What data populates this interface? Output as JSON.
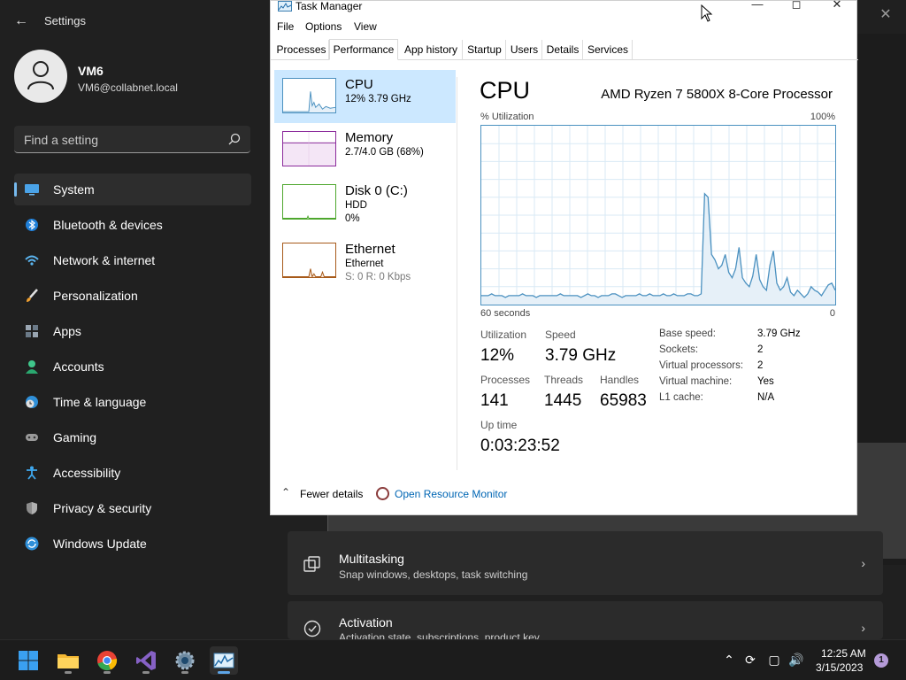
{
  "settings": {
    "title": "Settings",
    "profile": {
      "name": "VM6",
      "email": "VM6@collabnet.local"
    },
    "search": {
      "placeholder": "Find a setting"
    },
    "nav": [
      {
        "label": "System",
        "icon": "monitor-icon",
        "active": true
      },
      {
        "label": "Bluetooth & devices",
        "icon": "bluetooth-icon"
      },
      {
        "label": "Network & internet",
        "icon": "wifi-icon"
      },
      {
        "label": "Personalization",
        "icon": "brush-icon"
      },
      {
        "label": "Apps",
        "icon": "apps-icon"
      },
      {
        "label": "Accounts",
        "icon": "person-icon"
      },
      {
        "label": "Time & language",
        "icon": "clock-globe-icon"
      },
      {
        "label": "Gaming",
        "icon": "gamepad-icon"
      },
      {
        "label": "Accessibility",
        "icon": "accessibility-icon"
      },
      {
        "label": "Privacy & security",
        "icon": "shield-icon"
      },
      {
        "label": "Windows Update",
        "icon": "update-icon"
      }
    ],
    "cards": [
      {
        "title": "Multitasking",
        "subtitle": "Snap windows, desktops, task switching",
        "icon": "multitask-icon"
      },
      {
        "title": "Activation",
        "subtitle": "Activation state, subscriptions, product key",
        "icon": "check-circle-icon"
      }
    ]
  },
  "taskmanager": {
    "title": "Task Manager",
    "menu": [
      "File",
      "Options",
      "View"
    ],
    "tabs": [
      "Processes",
      "Performance",
      "App history",
      "Startup",
      "Users",
      "Details",
      "Services"
    ],
    "active_tab": "Performance",
    "sidebar": [
      {
        "name": "CPU",
        "line1": "12% 3.79 GHz",
        "line2": "",
        "color": "#4b91c0"
      },
      {
        "name": "Memory",
        "line1": "2.7/4.0 GB (68%)",
        "line2": "",
        "color": "#8b2a9b"
      },
      {
        "name": "Disk 0 (C:)",
        "line1": "HDD",
        "line2": "0%",
        "color": "#4ea72e"
      },
      {
        "name": "Ethernet",
        "line1": "Ethernet",
        "line2": "S: 0 R: 0 Kbps",
        "color": "#a75a1a"
      }
    ],
    "cpu": {
      "heading": "CPU",
      "model": "AMD Ryzen 7 5800X 8-Core Processor",
      "util_label": "% Utilization",
      "util_max": "100%",
      "x_left": "60 seconds",
      "x_right": "0",
      "stats": {
        "utilization_label": "Utilization",
        "utilization": "12%",
        "speed_label": "Speed",
        "speed": "3.79 GHz",
        "processes_label": "Processes",
        "processes": "141",
        "threads_label": "Threads",
        "threads": "1445",
        "handles_label": "Handles",
        "handles": "65983",
        "uptime_label": "Up time",
        "uptime": "0:03:23:52"
      },
      "details": [
        {
          "k": "Base speed:",
          "v": "3.79 GHz"
        },
        {
          "k": "Sockets:",
          "v": "2"
        },
        {
          "k": "Virtual processors:",
          "v": "2"
        },
        {
          "k": "Virtual machine:",
          "v": "Yes"
        },
        {
          "k": "L1 cache:",
          "v": "N/A"
        }
      ]
    },
    "footer": {
      "fewer_details": "Fewer details",
      "resource_monitor": "Open Resource Monitor"
    }
  },
  "chart_data": {
    "type": "line",
    "title": "",
    "ylabel": "% Utilization",
    "ylim": [
      0,
      100
    ],
    "x_range_seconds": [
      60,
      0
    ],
    "values": [
      5,
      5,
      5,
      6,
      5,
      5,
      5,
      4,
      5,
      5,
      5,
      5,
      6,
      5,
      5,
      5,
      4,
      5,
      5,
      5,
      5,
      5,
      5,
      6,
      5,
      5,
      5,
      5,
      5,
      4,
      5,
      6,
      5,
      5,
      4,
      5,
      5,
      5,
      6,
      6,
      5,
      4,
      5,
      5,
      5,
      5,
      6,
      5,
      5,
      6,
      5,
      5,
      5,
      6,
      5,
      5,
      6,
      5,
      5,
      5,
      6,
      6,
      5,
      5,
      6,
      62,
      60,
      28,
      25,
      20,
      22,
      28,
      18,
      15,
      20,
      32,
      15,
      12,
      10,
      16,
      28,
      14,
      10,
      8,
      22,
      30,
      12,
      8,
      10,
      15,
      7,
      5,
      8,
      6,
      4,
      6,
      10,
      8,
      7,
      5,
      8,
      11,
      12,
      8
    ],
    "color": "#4b91c0",
    "fill": "#e6f0f8"
  },
  "taskbar": {
    "apps": [
      "start-icon",
      "file-explorer-icon",
      "chrome-icon",
      "visual-studio-icon",
      "settings-gear-icon",
      "task-manager-icon"
    ],
    "time": "12:25 AM",
    "date": "3/15/2023",
    "notifications": "1"
  }
}
